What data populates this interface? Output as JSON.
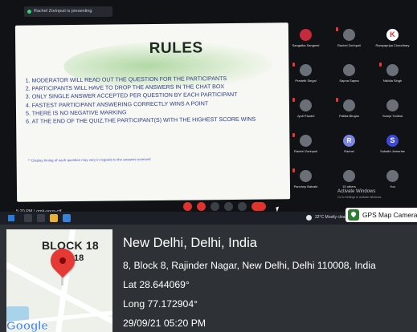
{
  "meeting": {
    "presenting_text": "Rachel Zorinpuii is presenting",
    "meeting_code": "5:20 PM | omk-yous-ctf",
    "activate_title": "Activate Windows",
    "activate_sub": "Go to Settings to activate Windows."
  },
  "slide": {
    "title": "RULES",
    "rules": [
      "1.  MODERATOR WILL READ OUT THE QUESTION FOR THE PARTICIPANTS",
      "2.  PARTICIPANTS WILL HAVE TO DROP THE ANSWERS IN THE CHAT BOX",
      "3.  ONLY SINGLE ANSWER ACCEPTED PER QUESTION BY EACH PARTICIPANT",
      "4.  FASTEST PARTICIPANT ANSWERING CORRECTLY WINS A POINT",
      "5.  THERE IS NO NEGATIVE MARKING",
      "6.  AT THE END OF THE QUIZ,THE PARTICIPANT(S) WITH THE HIGHEST SCORE WINS"
    ],
    "note": "** Display timing of each question may vary in regards to the answers received"
  },
  "participants": [
    {
      "name": "Sangaiba Sangmei",
      "letter": ""
    },
    {
      "name": "Rachel Zorinpuii",
      "letter": ""
    },
    {
      "name": "Ramyapriya Choudhary",
      "letter": "K"
    },
    {
      "name": "Pradeth Singal",
      "letter": ""
    },
    {
      "name": "Sapna Sapna",
      "letter": ""
    },
    {
      "name": "Nikhila Singh",
      "letter": ""
    },
    {
      "name": "Jyoti Paudel",
      "letter": ""
    },
    {
      "name": "Pabita Bhujan",
      "letter": ""
    },
    {
      "name": "Sumpi Tonlina",
      "letter": ""
    },
    {
      "name": "Rachel Zorinpuii",
      "letter": ""
    },
    {
      "name": "Rachel",
      "letter": "R"
    },
    {
      "name": "Subaibi Jemerise",
      "letter": "S"
    },
    {
      "name": "Panchoy Baivalh",
      "letter": ""
    },
    {
      "name": "15 others",
      "letter": ""
    },
    {
      "name": "You",
      "letter": ""
    }
  ],
  "taskbar": {
    "weather": "32°C  Mostly clear"
  },
  "gps": {
    "app_label": "GPS Map Camera",
    "map_block_label": "BLOCK 18",
    "map_block_number": "18",
    "google_label": "Google",
    "place": "New Delhi, Delhi, India",
    "address": "8, Block 8, Rajinder Nagar, New Delhi, Delhi 110008, India",
    "lat": "Lat 28.644069°",
    "long": "Long 77.172904°",
    "datetime": "29/09/21 05:20 PM"
  },
  "colors": {
    "rules_text": "#2b3c85",
    "toolbar_red": "#e0332d",
    "pin": "#e53935",
    "overlay_bg": "#2e3136"
  }
}
